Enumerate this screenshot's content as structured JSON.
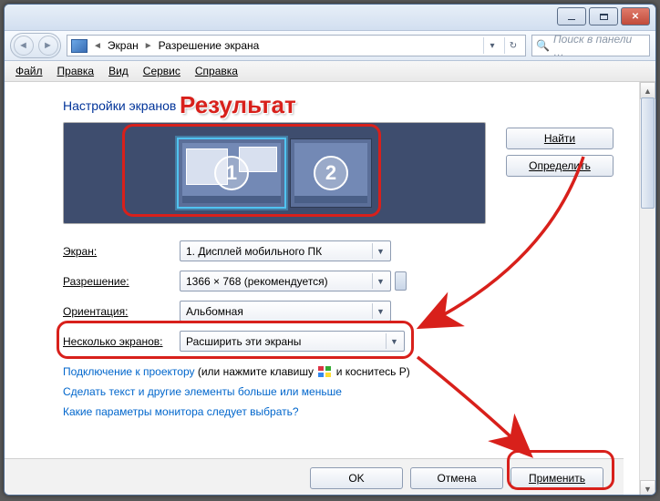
{
  "breadcrumbs": {
    "root": "Экран",
    "current": "Разрешение экрана"
  },
  "search": {
    "placeholder": "Поиск в панели …"
  },
  "menubar": {
    "file": "Файл",
    "edit": "Правка",
    "view": "Вид",
    "tools": "Сервис",
    "help": "Справка"
  },
  "page": {
    "title": "Настройки экранов"
  },
  "preview": {
    "monitor1": "1",
    "monitor2": "2"
  },
  "buttons": {
    "find": "Найти",
    "detect": "Определить",
    "ok": "OK",
    "cancel": "Отмена",
    "apply": "Применить"
  },
  "form": {
    "screen_label": "Экран:",
    "screen_value": "1. Дисплей мобильного ПК",
    "resolution_label": "Разрешение:",
    "resolution_value": "1366 × 768 (рекомендуется)",
    "orientation_label": "Ориентация:",
    "orientation_value": "Альбомная",
    "multi_label": "Несколько экранов:",
    "multi_value": "Расширить эти экраны"
  },
  "links": {
    "projector_link": "Подключение к проектору",
    "projector_suffix": " (или нажмите клавишу ",
    "projector_suffix2": " и коснитесь P)",
    "text_size": "Сделать текст и другие элементы больше или меньше",
    "monitor_params": "Какие параметры монитора следует выбрать?"
  },
  "annotation": {
    "result": "Результат"
  }
}
